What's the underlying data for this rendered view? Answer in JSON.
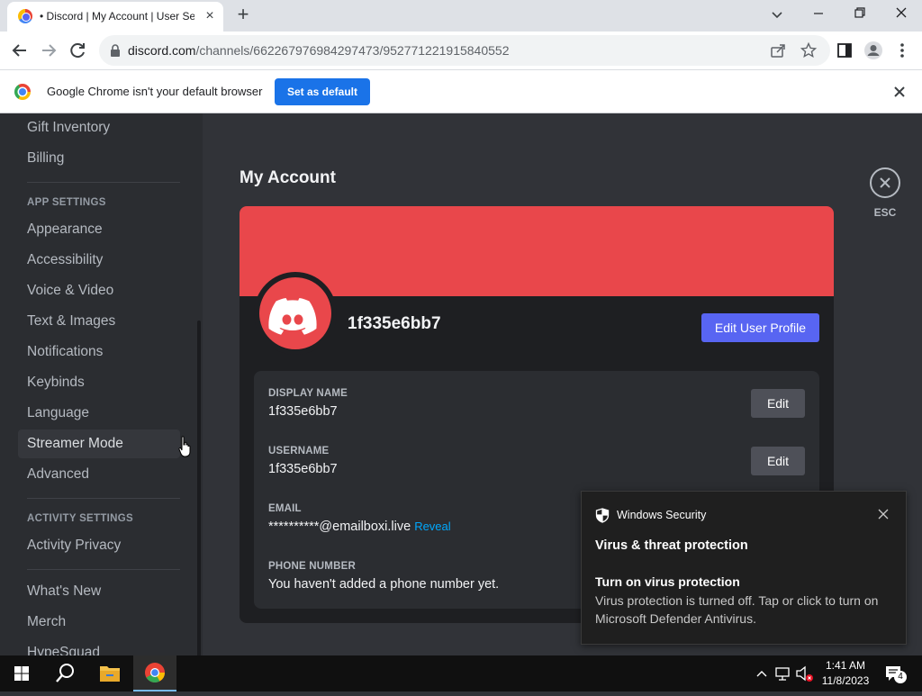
{
  "browser": {
    "tab_title": "• Discord | My Account | User Se",
    "url_domain": "discord.com",
    "url_path": "/channels/662267976984297473/952771221915840552"
  },
  "infobar": {
    "message": "Google Chrome isn't your default browser",
    "set_default_label": "Set as default"
  },
  "sidebar": {
    "top_items": [
      {
        "label": "Gift Inventory"
      },
      {
        "label": "Billing"
      }
    ],
    "app_settings_header": "APP SETTINGS",
    "app_items": [
      {
        "label": "Appearance"
      },
      {
        "label": "Accessibility"
      },
      {
        "label": "Voice & Video"
      },
      {
        "label": "Text & Images"
      },
      {
        "label": "Notifications"
      },
      {
        "label": "Keybinds"
      },
      {
        "label": "Language"
      },
      {
        "label": "Streamer Mode"
      },
      {
        "label": "Advanced"
      }
    ],
    "activity_settings_header": "ACTIVITY SETTINGS",
    "activity_items": [
      {
        "label": "Activity Privacy"
      }
    ],
    "misc_items": [
      {
        "label": "What's New"
      },
      {
        "label": "Merch"
      },
      {
        "label": "HypeSquad"
      }
    ]
  },
  "main": {
    "title": "My Account",
    "esc_label": "ESC",
    "username": "1f335e6bb7",
    "edit_profile_label": "Edit User Profile",
    "fields": {
      "display_name_label": "DISPLAY NAME",
      "display_name_value": "1f335e6bb7",
      "username_label": "USERNAME",
      "username_value": "1f335e6bb7",
      "email_label": "EMAIL",
      "email_value": "**********@emailboxi.live",
      "reveal_label": "Reveal",
      "phone_label": "PHONE NUMBER",
      "phone_value": "You haven't added a phone number yet.",
      "edit_label": "Edit"
    }
  },
  "toast": {
    "app_name": "Windows Security",
    "heading": "Virus & threat protection",
    "subheading": "Turn on virus protection",
    "body": "Virus protection is turned off. Tap or click to turn on Microsoft Defender Antivirus."
  },
  "taskbar": {
    "time": "1:41 AM",
    "date": "11/8/2023",
    "notification_count": "4"
  },
  "colors": {
    "banner": "#e9474b",
    "blurple": "#5865f2",
    "chrome_blue": "#1a73e8",
    "link": "#00a8fc"
  }
}
